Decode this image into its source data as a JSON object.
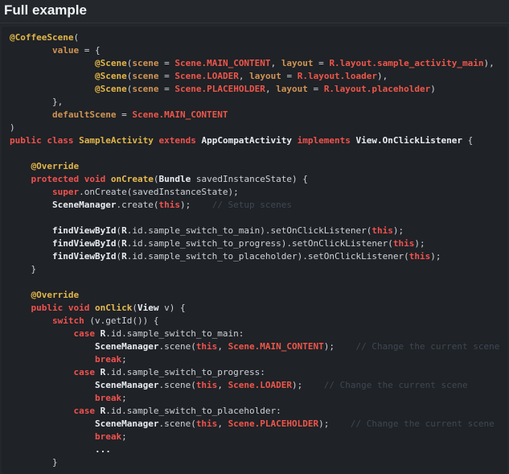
{
  "page": {
    "title": "Full example"
  },
  "colors": {
    "background": "#24272b",
    "code_background": "#1f2226",
    "heading_text": "#f0f3f6",
    "plain": "#ced3d8",
    "keyword": "#f0524f",
    "annotation": "#e3b64a",
    "class_name": "#e3b64a",
    "method_name": "#e8bb51",
    "parameter": "#d19455",
    "constant": "#ee564b",
    "bold_identifier": "#e9edf1",
    "comment": "#3d4854"
  },
  "code": {
    "lines": [
      [
        [
          "ann",
          "@CoffeeScene"
        ],
        [
          "p",
          "("
        ]
      ],
      [
        [
          "p",
          "        "
        ],
        [
          "param",
          "value"
        ],
        [
          "p",
          " = {"
        ]
      ],
      [
        [
          "p",
          "                "
        ],
        [
          "ann",
          "@Scene"
        ],
        [
          "p",
          "("
        ],
        [
          "param",
          "scene"
        ],
        [
          "p",
          " = "
        ],
        [
          "const",
          "Scene.MAIN_CONTENT"
        ],
        [
          "p",
          ", "
        ],
        [
          "param",
          "layout"
        ],
        [
          "p",
          " = "
        ],
        [
          "const",
          "R.layout.sample_activity_main"
        ],
        [
          "p",
          "),"
        ]
      ],
      [
        [
          "p",
          "                "
        ],
        [
          "ann",
          "@Scene"
        ],
        [
          "p",
          "("
        ],
        [
          "param",
          "scene"
        ],
        [
          "p",
          " = "
        ],
        [
          "const",
          "Scene.LOADER"
        ],
        [
          "p",
          ", "
        ],
        [
          "param",
          "layout"
        ],
        [
          "p",
          " = "
        ],
        [
          "const",
          "R.layout.loader"
        ],
        [
          "p",
          "),"
        ]
      ],
      [
        [
          "p",
          "                "
        ],
        [
          "ann",
          "@Scene"
        ],
        [
          "p",
          "("
        ],
        [
          "param",
          "scene"
        ],
        [
          "p",
          " = "
        ],
        [
          "const",
          "Scene.PLACEHOLDER"
        ],
        [
          "p",
          ", "
        ],
        [
          "param",
          "layout"
        ],
        [
          "p",
          " = "
        ],
        [
          "const",
          "R.layout.placeholder"
        ],
        [
          "p",
          ")"
        ]
      ],
      [
        [
          "p",
          "        },"
        ]
      ],
      [
        [
          "p",
          "        "
        ],
        [
          "param",
          "defaultScene"
        ],
        [
          "p",
          " = "
        ],
        [
          "const",
          "Scene.MAIN_CONTENT"
        ]
      ],
      [
        [
          "p",
          ")"
        ]
      ],
      [
        [
          "kw",
          "public"
        ],
        [
          "p",
          " "
        ],
        [
          "kw",
          "class"
        ],
        [
          "p",
          " "
        ],
        [
          "cls",
          "SampleActivity"
        ],
        [
          "p",
          " "
        ],
        [
          "kw",
          "extends"
        ],
        [
          "p",
          " "
        ],
        [
          "b",
          "AppCompatActivity"
        ],
        [
          "p",
          " "
        ],
        [
          "kw",
          "implements"
        ],
        [
          "p",
          " "
        ],
        [
          "b",
          "View.OnClickListener"
        ],
        [
          "p",
          " {"
        ]
      ],
      [],
      [
        [
          "p",
          "    "
        ],
        [
          "ann",
          "@Override"
        ]
      ],
      [
        [
          "p",
          "    "
        ],
        [
          "kw",
          "protected"
        ],
        [
          "p",
          " "
        ],
        [
          "kw",
          "void"
        ],
        [
          "p",
          " "
        ],
        [
          "method",
          "onCreate"
        ],
        [
          "p",
          "("
        ],
        [
          "b",
          "Bundle"
        ],
        [
          "p",
          " savedInstanceState) {"
        ]
      ],
      [
        [
          "p",
          "        "
        ],
        [
          "kw",
          "super"
        ],
        [
          "p",
          ".onCreate(savedInstanceState);"
        ]
      ],
      [
        [
          "p",
          "        "
        ],
        [
          "b",
          "SceneManager"
        ],
        [
          "p",
          ".create("
        ],
        [
          "kw",
          "this"
        ],
        [
          "p",
          ");"
        ],
        [
          "cmt",
          "    // Setup scenes"
        ]
      ],
      [],
      [
        [
          "p",
          "        "
        ],
        [
          "b",
          "findViewById"
        ],
        [
          "p",
          "("
        ],
        [
          "b",
          "R"
        ],
        [
          "p",
          ".id.sample_switch_to_main).setOnClickListener("
        ],
        [
          "kw",
          "this"
        ],
        [
          "p",
          ");"
        ]
      ],
      [
        [
          "p",
          "        "
        ],
        [
          "b",
          "findViewById"
        ],
        [
          "p",
          "("
        ],
        [
          "b",
          "R"
        ],
        [
          "p",
          ".id.sample_switch_to_progress).setOnClickListener("
        ],
        [
          "kw",
          "this"
        ],
        [
          "p",
          ");"
        ]
      ],
      [
        [
          "p",
          "        "
        ],
        [
          "b",
          "findViewById"
        ],
        [
          "p",
          "("
        ],
        [
          "b",
          "R"
        ],
        [
          "p",
          ".id.sample_switch_to_placeholder).setOnClickListener("
        ],
        [
          "kw",
          "this"
        ],
        [
          "p",
          ");"
        ]
      ],
      [
        [
          "p",
          "    }"
        ]
      ],
      [],
      [
        [
          "p",
          "    "
        ],
        [
          "ann",
          "@Override"
        ]
      ],
      [
        [
          "p",
          "    "
        ],
        [
          "kw",
          "public"
        ],
        [
          "p",
          " "
        ],
        [
          "kw",
          "void"
        ],
        [
          "p",
          " "
        ],
        [
          "method",
          "onClick"
        ],
        [
          "p",
          "("
        ],
        [
          "b",
          "View"
        ],
        [
          "p",
          " v) {"
        ]
      ],
      [
        [
          "p",
          "        "
        ],
        [
          "kw",
          "switch"
        ],
        [
          "p",
          " (v.getId()) {"
        ]
      ],
      [
        [
          "p",
          "            "
        ],
        [
          "kw",
          "case"
        ],
        [
          "p",
          " "
        ],
        [
          "b",
          "R"
        ],
        [
          "p",
          ".id.sample_switch_to_main:"
        ]
      ],
      [
        [
          "p",
          "                "
        ],
        [
          "b",
          "SceneManager"
        ],
        [
          "p",
          ".scene("
        ],
        [
          "kw",
          "this"
        ],
        [
          "p",
          ", "
        ],
        [
          "const",
          "Scene.MAIN_CONTENT"
        ],
        [
          "p",
          ");"
        ],
        [
          "cmt",
          "    // Change the current scene"
        ]
      ],
      [
        [
          "p",
          "                "
        ],
        [
          "kw",
          "break"
        ],
        [
          "p",
          ";"
        ]
      ],
      [
        [
          "p",
          "            "
        ],
        [
          "kw",
          "case"
        ],
        [
          "p",
          " "
        ],
        [
          "b",
          "R"
        ],
        [
          "p",
          ".id.sample_switch_to_progress:"
        ]
      ],
      [
        [
          "p",
          "                "
        ],
        [
          "b",
          "SceneManager"
        ],
        [
          "p",
          ".scene("
        ],
        [
          "kw",
          "this"
        ],
        [
          "p",
          ", "
        ],
        [
          "const",
          "Scene.LOADER"
        ],
        [
          "p",
          ");"
        ],
        [
          "cmt",
          "    // Change the current scene"
        ]
      ],
      [
        [
          "p",
          "                "
        ],
        [
          "kw",
          "break"
        ],
        [
          "p",
          ";"
        ]
      ],
      [
        [
          "p",
          "            "
        ],
        [
          "kw",
          "case"
        ],
        [
          "p",
          " "
        ],
        [
          "b",
          "R"
        ],
        [
          "p",
          ".id.sample_switch_to_placeholder:"
        ]
      ],
      [
        [
          "p",
          "                "
        ],
        [
          "b",
          "SceneManager"
        ],
        [
          "p",
          ".scene("
        ],
        [
          "kw",
          "this"
        ],
        [
          "p",
          ", "
        ],
        [
          "const",
          "Scene.PLACEHOLDER"
        ],
        [
          "p",
          ");"
        ],
        [
          "cmt",
          "    // Change the current scene"
        ]
      ],
      [
        [
          "p",
          "                "
        ],
        [
          "kw",
          "break"
        ],
        [
          "p",
          ";"
        ]
      ],
      [
        [
          "p",
          "                "
        ],
        [
          "b",
          "..."
        ]
      ],
      [
        [
          "p",
          "        }"
        ]
      ]
    ]
  }
}
